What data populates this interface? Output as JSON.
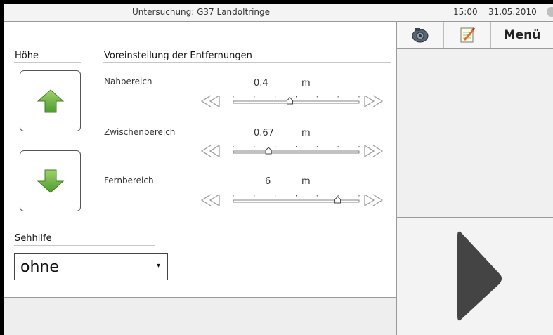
{
  "window": {
    "title": "Untersuchung: G37 Landoltringe",
    "time": "15:00",
    "date": "31.05.2010"
  },
  "height_section": {
    "heading": "Höhe"
  },
  "distances": {
    "heading": "Voreinstellung der Entfernungen",
    "items": [
      {
        "label": "Nahbereich",
        "value": "0.4",
        "unit": "m",
        "slider_fraction": 0.45
      },
      {
        "label": "Zwischenbereich",
        "value": "0.67",
        "unit": "m",
        "slider_fraction": 0.28
      },
      {
        "label": "Fernbereich",
        "value": "6",
        "unit": "m",
        "slider_fraction": 0.83
      }
    ]
  },
  "vision_aid": {
    "heading": "Sehhilfe",
    "selected": "ohne"
  },
  "sidebar": {
    "menu_label": "Menü",
    "icons": [
      "camera-icon",
      "notepad-icon"
    ]
  }
}
